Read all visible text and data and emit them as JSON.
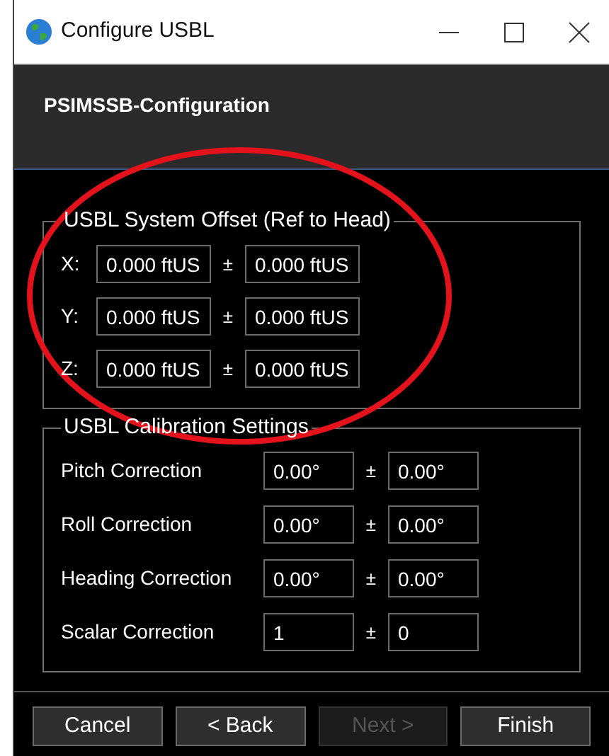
{
  "window": {
    "title": "Configure USBL",
    "controls": [
      {
        "kind": "minimize"
      },
      {
        "kind": "maximize"
      },
      {
        "kind": "close"
      }
    ]
  },
  "header": {
    "title": "PSIMSSB-Configuration"
  },
  "offset_group": {
    "title": "USBL System Offset (Ref to Head)",
    "rows": [
      {
        "label": "X:",
        "value": "0.000 ftUS",
        "separator": "±",
        "tolerance": "0.000 ftUS"
      },
      {
        "label": "Y:",
        "value": "0.000 ftUS",
        "separator": "±",
        "tolerance": "0.000 ftUS"
      },
      {
        "label": "Z:",
        "value": "0.000 ftUS",
        "separator": "±",
        "tolerance": "0.000 ftUS"
      }
    ]
  },
  "calibration_group": {
    "title": "USBL Calibration Settings",
    "rows": [
      {
        "label": "Pitch Correction",
        "value": "0.00°",
        "separator": "±",
        "tolerance": "0.00°"
      },
      {
        "label": "Roll Correction",
        "value": "0.00°",
        "separator": "±",
        "tolerance": "0.00°"
      },
      {
        "label": "Heading Correction",
        "value": "0.00°",
        "separator": "±",
        "tolerance": "0.00°"
      },
      {
        "label": "Scalar Correction",
        "value": "1",
        "separator": "±",
        "tolerance": "0"
      }
    ]
  },
  "buttons": [
    {
      "label": "Cancel",
      "disabled": false
    },
    {
      "label": "< Back",
      "disabled": false
    },
    {
      "label": "Next >",
      "disabled": true
    },
    {
      "label": "Finish",
      "disabled": false
    }
  ],
  "annotation": {
    "color": "#e3121b"
  }
}
